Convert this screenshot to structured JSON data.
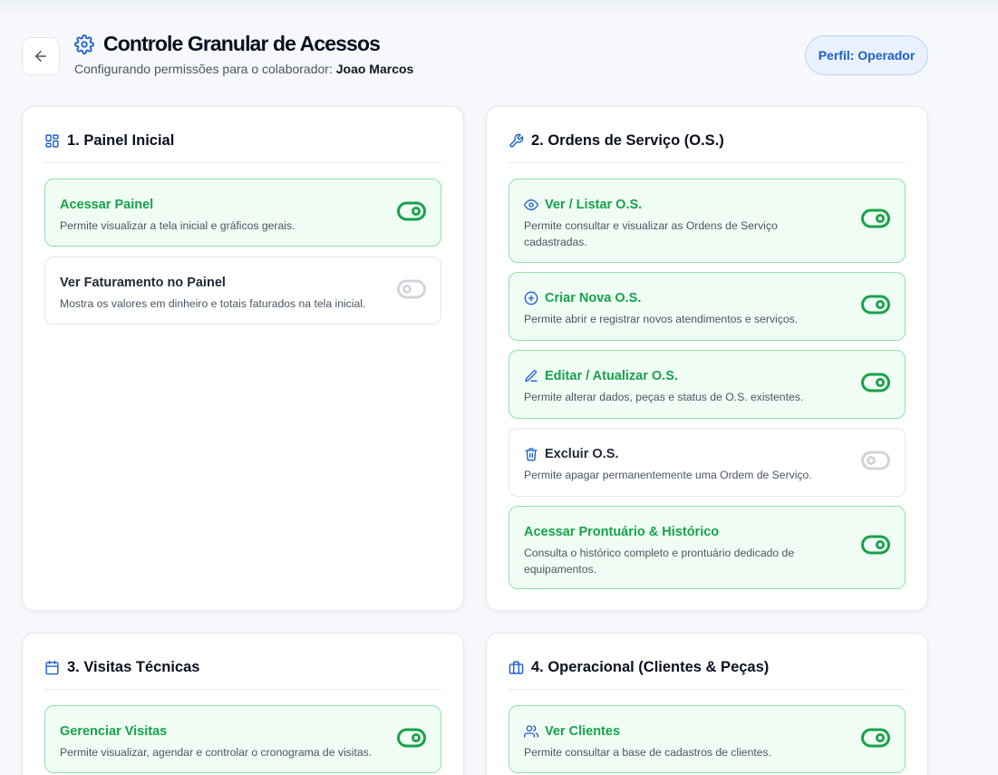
{
  "header": {
    "title": "Controle Granular de Acessos",
    "subtitle_prefix": "Configurando permissões para o colaborador:",
    "employee_name": "Joao Marcos",
    "profile_badge": "Perfil: Operador"
  },
  "colors": {
    "accent_blue": "#1d5ec9",
    "enabled_green": "#16a34a",
    "disabled_gray": "#d1d5db"
  },
  "sections": [
    {
      "icon": "dashboard-grid-icon",
      "title": "1. Painel Inicial",
      "permissions": [
        {
          "title": "Acessar Painel",
          "description": "Permite visualizar a tela inicial e gráficos gerais.",
          "enabled": true
        },
        {
          "title": "Ver Faturamento no Painel",
          "description": "Mostra os valores em dinheiro e totais faturados na tela inicial.",
          "enabled": false
        }
      ]
    },
    {
      "icon": "wrench-icon",
      "title": "2. Ordens de Serviço (O.S.)",
      "permissions": [
        {
          "icon": "eye-icon",
          "title": "Ver / Listar O.S.",
          "description": "Permite consultar e visualizar as Ordens de Serviço cadastradas.",
          "enabled": true
        },
        {
          "icon": "plus-circle-icon",
          "title": "Criar Nova O.S.",
          "description": "Permite abrir e registrar novos atendimentos e serviços.",
          "enabled": true
        },
        {
          "icon": "pencil-icon",
          "title": "Editar / Atualizar O.S.",
          "description": "Permite alterar dados, peças e status de O.S. existentes.",
          "enabled": true
        },
        {
          "icon": "trash-icon",
          "title": "Excluir O.S.",
          "description": "Permite apagar permanentemente uma Ordem de Serviço.",
          "enabled": false
        },
        {
          "title": "Acessar Prontuário & Histórico",
          "description": "Consulta o histórico completo e prontuário dedicado de equipamentos.",
          "enabled": true
        }
      ]
    },
    {
      "icon": "calendar-icon",
      "title": "3. Visitas Técnicas",
      "permissions": [
        {
          "title": "Gerenciar Visitas",
          "description": "Permite visualizar, agendar e controlar o cronograma de visitas.",
          "enabled": true
        }
      ]
    },
    {
      "icon": "briefcase-icon",
      "title": "4. Operacional (Clientes & Peças)",
      "permissions": [
        {
          "icon": "users-icon",
          "title": "Ver Clientes",
          "description": "Permite consultar a base de cadastros de clientes.",
          "enabled": true
        }
      ]
    }
  ]
}
